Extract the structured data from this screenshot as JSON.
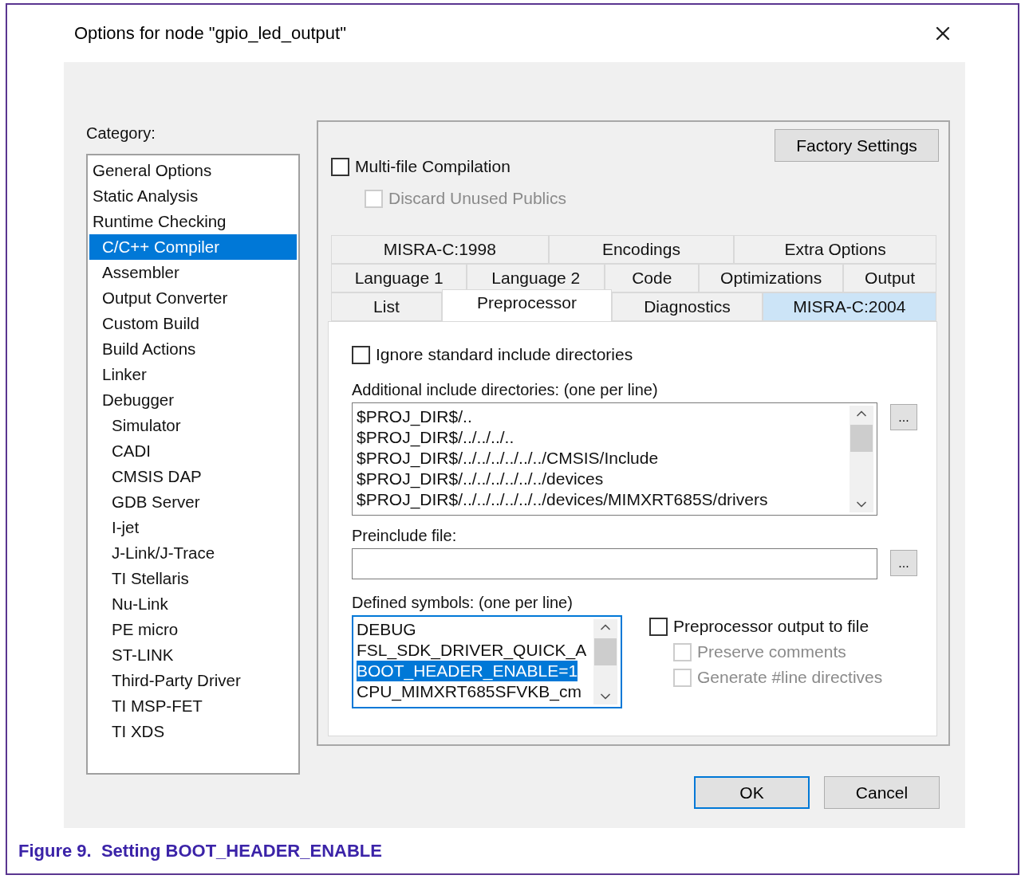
{
  "window": {
    "title": "Options for node \"gpio_led_output\""
  },
  "category": {
    "label": "Category:",
    "items": [
      {
        "label": "General Options",
        "selected": false
      },
      {
        "label": "Static Analysis",
        "selected": false
      },
      {
        "label": "Runtime Checking",
        "selected": false,
        "children": [
          {
            "label": "C/C++ Compiler",
            "selected": true
          },
          {
            "label": "Assembler",
            "selected": false
          },
          {
            "label": "Output Converter",
            "selected": false
          },
          {
            "label": "Custom Build",
            "selected": false
          },
          {
            "label": "Build Actions",
            "selected": false
          },
          {
            "label": "Linker",
            "selected": false
          },
          {
            "label": "Debugger",
            "selected": false,
            "children": [
              {
                "label": "Simulator",
                "selected": false
              },
              {
                "label": "CADI",
                "selected": false
              },
              {
                "label": "CMSIS DAP",
                "selected": false
              },
              {
                "label": "GDB Server",
                "selected": false
              },
              {
                "label": "I-jet",
                "selected": false
              },
              {
                "label": "J-Link/J-Trace",
                "selected": false
              },
              {
                "label": "TI Stellaris",
                "selected": false
              },
              {
                "label": "Nu-Link",
                "selected": false
              },
              {
                "label": "PE micro",
                "selected": false
              },
              {
                "label": "ST-LINK",
                "selected": false
              },
              {
                "label": "Third-Party Driver",
                "selected": false
              },
              {
                "label": "TI MSP-FET",
                "selected": false
              },
              {
                "label": "TI XDS",
                "selected": false
              }
            ]
          }
        ]
      }
    ]
  },
  "factory_button": "Factory Settings",
  "multi_file": {
    "label": "Multi-file Compilation",
    "checked": false,
    "disabled": false
  },
  "discard_publics": {
    "label": "Discard Unused Publics",
    "checked": false,
    "disabled": true
  },
  "tab_rows": [
    [
      {
        "label": "MISRA-C:1998",
        "selected": false,
        "highlighted": false
      },
      {
        "label": "Encodings",
        "selected": false,
        "highlighted": false
      },
      {
        "label": "Extra Options",
        "selected": false,
        "highlighted": false
      }
    ],
    [
      {
        "label": "Language 1",
        "selected": false,
        "highlighted": false
      },
      {
        "label": "Language 2",
        "selected": false,
        "highlighted": false
      },
      {
        "label": "Code",
        "selected": false,
        "highlighted": false
      },
      {
        "label": "Optimizations",
        "selected": false,
        "highlighted": false
      },
      {
        "label": "Output",
        "selected": false,
        "highlighted": false
      }
    ],
    [
      {
        "label": "List",
        "selected": false,
        "highlighted": false
      },
      {
        "label": "Preprocessor",
        "selected": true,
        "highlighted": false
      },
      {
        "label": "Diagnostics",
        "selected": false,
        "highlighted": false
      },
      {
        "label": "MISRA-C:2004",
        "selected": false,
        "highlighted": true
      }
    ]
  ],
  "ignore_std": {
    "label": "Ignore standard include directories",
    "checked": false,
    "disabled": false
  },
  "include_dirs": {
    "label": "Additional include directories: (one per line)",
    "lines": [
      "$PROJ_DIR$/..",
      "$PROJ_DIR$/../../../..",
      "$PROJ_DIR$/../../../../../../CMSIS/Include",
      "$PROJ_DIR$/../../../../../../devices",
      "$PROJ_DIR$/../../../../../../devices/MIMXRT685S/drivers"
    ],
    "browse": "..."
  },
  "preinclude": {
    "label": "Preinclude file:",
    "browse": "..."
  },
  "defined_symbols": {
    "label": "Defined symbols: (one per line)",
    "lines": [
      {
        "text": "DEBUG",
        "selected": false
      },
      {
        "text": "FSL_SDK_DRIVER_QUICK_A",
        "selected": false
      },
      {
        "text": "BOOT_HEADER_ENABLE=1",
        "selected": true
      },
      {
        "text": "CPU_MIMXRT685SFVKB_cm",
        "selected": false
      }
    ]
  },
  "preprocessor_output": [
    {
      "label": "Preprocessor output to file",
      "checked": false,
      "disabled": false
    },
    {
      "label": "Preserve comments",
      "checked": false,
      "disabled": true
    },
    {
      "label": "Generate #line directives",
      "checked": false,
      "disabled": true
    }
  ],
  "buttons": [
    {
      "label": "OK",
      "default": true
    },
    {
      "label": "Cancel",
      "default": false
    }
  ],
  "caption": "Figure 9.  Setting BOOT_HEADER_ENABLE"
}
